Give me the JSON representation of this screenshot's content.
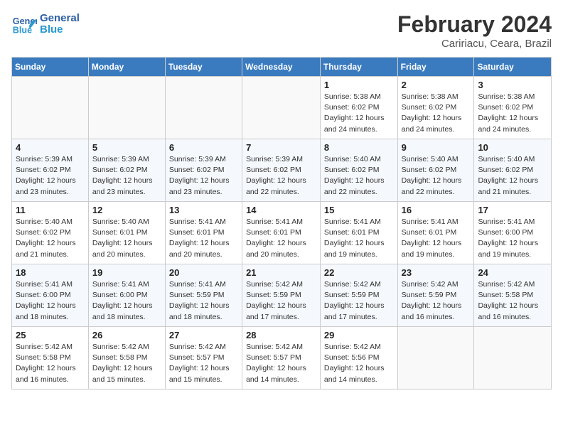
{
  "logo": {
    "text_general": "General",
    "text_blue": "Blue"
  },
  "header": {
    "month_year": "February 2024",
    "location": "Caririacu, Ceara, Brazil"
  },
  "weekdays": [
    "Sunday",
    "Monday",
    "Tuesday",
    "Wednesday",
    "Thursday",
    "Friday",
    "Saturday"
  ],
  "weeks": [
    [
      {
        "day": "",
        "info": ""
      },
      {
        "day": "",
        "info": ""
      },
      {
        "day": "",
        "info": ""
      },
      {
        "day": "",
        "info": ""
      },
      {
        "day": "1",
        "info": "Sunrise: 5:38 AM\nSunset: 6:02 PM\nDaylight: 12 hours and 24 minutes."
      },
      {
        "day": "2",
        "info": "Sunrise: 5:38 AM\nSunset: 6:02 PM\nDaylight: 12 hours and 24 minutes."
      },
      {
        "day": "3",
        "info": "Sunrise: 5:38 AM\nSunset: 6:02 PM\nDaylight: 12 hours and 24 minutes."
      }
    ],
    [
      {
        "day": "4",
        "info": "Sunrise: 5:39 AM\nSunset: 6:02 PM\nDaylight: 12 hours and 23 minutes."
      },
      {
        "day": "5",
        "info": "Sunrise: 5:39 AM\nSunset: 6:02 PM\nDaylight: 12 hours and 23 minutes."
      },
      {
        "day": "6",
        "info": "Sunrise: 5:39 AM\nSunset: 6:02 PM\nDaylight: 12 hours and 23 minutes."
      },
      {
        "day": "7",
        "info": "Sunrise: 5:39 AM\nSunset: 6:02 PM\nDaylight: 12 hours and 22 minutes."
      },
      {
        "day": "8",
        "info": "Sunrise: 5:40 AM\nSunset: 6:02 PM\nDaylight: 12 hours and 22 minutes."
      },
      {
        "day": "9",
        "info": "Sunrise: 5:40 AM\nSunset: 6:02 PM\nDaylight: 12 hours and 22 minutes."
      },
      {
        "day": "10",
        "info": "Sunrise: 5:40 AM\nSunset: 6:02 PM\nDaylight: 12 hours and 21 minutes."
      }
    ],
    [
      {
        "day": "11",
        "info": "Sunrise: 5:40 AM\nSunset: 6:02 PM\nDaylight: 12 hours and 21 minutes."
      },
      {
        "day": "12",
        "info": "Sunrise: 5:40 AM\nSunset: 6:01 PM\nDaylight: 12 hours and 20 minutes."
      },
      {
        "day": "13",
        "info": "Sunrise: 5:41 AM\nSunset: 6:01 PM\nDaylight: 12 hours and 20 minutes."
      },
      {
        "day": "14",
        "info": "Sunrise: 5:41 AM\nSunset: 6:01 PM\nDaylight: 12 hours and 20 minutes."
      },
      {
        "day": "15",
        "info": "Sunrise: 5:41 AM\nSunset: 6:01 PM\nDaylight: 12 hours and 19 minutes."
      },
      {
        "day": "16",
        "info": "Sunrise: 5:41 AM\nSunset: 6:01 PM\nDaylight: 12 hours and 19 minutes."
      },
      {
        "day": "17",
        "info": "Sunrise: 5:41 AM\nSunset: 6:00 PM\nDaylight: 12 hours and 19 minutes."
      }
    ],
    [
      {
        "day": "18",
        "info": "Sunrise: 5:41 AM\nSunset: 6:00 PM\nDaylight: 12 hours and 18 minutes."
      },
      {
        "day": "19",
        "info": "Sunrise: 5:41 AM\nSunset: 6:00 PM\nDaylight: 12 hours and 18 minutes."
      },
      {
        "day": "20",
        "info": "Sunrise: 5:41 AM\nSunset: 5:59 PM\nDaylight: 12 hours and 18 minutes."
      },
      {
        "day": "21",
        "info": "Sunrise: 5:42 AM\nSunset: 5:59 PM\nDaylight: 12 hours and 17 minutes."
      },
      {
        "day": "22",
        "info": "Sunrise: 5:42 AM\nSunset: 5:59 PM\nDaylight: 12 hours and 17 minutes."
      },
      {
        "day": "23",
        "info": "Sunrise: 5:42 AM\nSunset: 5:59 PM\nDaylight: 12 hours and 16 minutes."
      },
      {
        "day": "24",
        "info": "Sunrise: 5:42 AM\nSunset: 5:58 PM\nDaylight: 12 hours and 16 minutes."
      }
    ],
    [
      {
        "day": "25",
        "info": "Sunrise: 5:42 AM\nSunset: 5:58 PM\nDaylight: 12 hours and 16 minutes."
      },
      {
        "day": "26",
        "info": "Sunrise: 5:42 AM\nSunset: 5:58 PM\nDaylight: 12 hours and 15 minutes."
      },
      {
        "day": "27",
        "info": "Sunrise: 5:42 AM\nSunset: 5:57 PM\nDaylight: 12 hours and 15 minutes."
      },
      {
        "day": "28",
        "info": "Sunrise: 5:42 AM\nSunset: 5:57 PM\nDaylight: 12 hours and 14 minutes."
      },
      {
        "day": "29",
        "info": "Sunrise: 5:42 AM\nSunset: 5:56 PM\nDaylight: 12 hours and 14 minutes."
      },
      {
        "day": "",
        "info": ""
      },
      {
        "day": "",
        "info": ""
      }
    ]
  ]
}
